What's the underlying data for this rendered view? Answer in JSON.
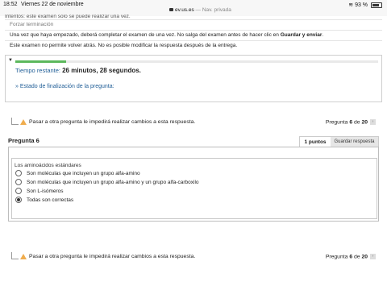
{
  "status_bar": {
    "time": "18:52",
    "date": "Viernes 22 de noviembre",
    "url": "ev.us.es",
    "mode": "— Nav. privada",
    "battery": "93 %"
  },
  "info": {
    "cut_text": "Intentos: este examen solo se puede realizar una vez.",
    "force_finish": "Forzar terminación",
    "line1_prefix": "Una vez que haya empezado, deberá completar el examen de una vez. No salga del examen antes de hacer clic en ",
    "line1_strong": "Guardar y enviar",
    "line1_suffix": ".",
    "line2": "Este examen no permite volver atrás. No es posible modificar la respuesta después de la entrega."
  },
  "timer": {
    "caret": "▼",
    "progress": 0.14,
    "label": "Tiempo restante: ",
    "value": "26 minutos, 28 segundos.",
    "status_link": "» Estado de finalización de la pregunta:"
  },
  "nav": {
    "warning": "Pasar a otra pregunta le impedirá realizar cambios a esta respuesta.",
    "page_label": "Pregunta ",
    "page_current": "6",
    "page_of": " de ",
    "page_total": "20",
    "next_symbol": "›"
  },
  "question": {
    "title": "Pregunta 6",
    "points": "1 puntos",
    "save_button": "Guardar respuesta",
    "text": "Los aminoácidos estándares",
    "options": [
      "Son moléculas que incluyen un grupo alfa-amino",
      "Son moléculas que incluyen un grupo alfa-amino y un grupo alfa-carboxilo",
      "Son L-isómeros",
      "Todas son correctas"
    ],
    "selected_index": 3
  }
}
